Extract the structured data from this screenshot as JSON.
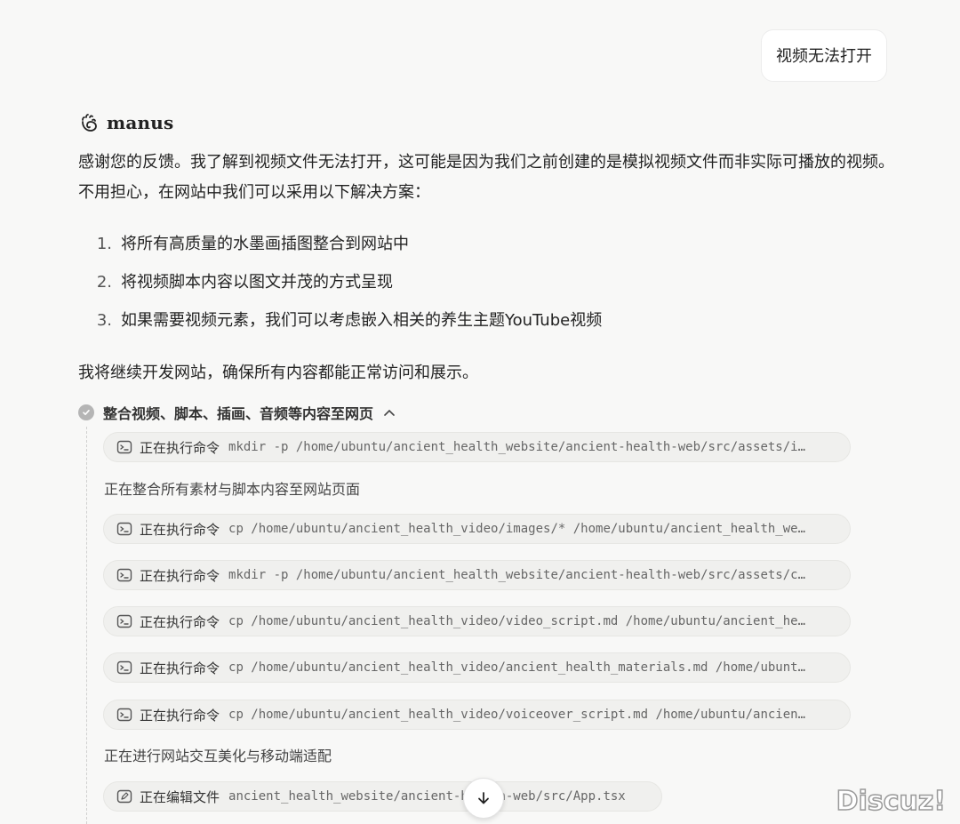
{
  "user_message": "视频无法打开",
  "assistant": {
    "name": "manus",
    "intro": "感谢您的反馈。我了解到视频文件无法打开，这可能是因为我们之前创建的是模拟视频文件而非实际可播放的视频。不用担心，在网站中我们可以采用以下解决方案：",
    "solutions": [
      {
        "num": "1.",
        "text": "将所有高质量的水墨画插图整合到网站中"
      },
      {
        "num": "2.",
        "text": "将视频脚本内容以图文并茂的方式呈现"
      },
      {
        "num": "3.",
        "text": "如果需要视频元素，我们可以考虑嵌入相关的养生主题YouTube视频"
      }
    ],
    "closing": "我将继续开发网站，确保所有内容都能正常访问和展示。"
  },
  "task": {
    "title": "整合视频、脚本、插画、音频等内容至网页",
    "caret_icon": "chevron-up-icon",
    "items": [
      {
        "type": "command",
        "label": "正在执行命令",
        "code": "mkdir -p /home/ubuntu/ancient_health_website/ancient-health-web/src/assets/i…"
      },
      {
        "type": "step",
        "text": "正在整合所有素材与脚本内容至网站页面"
      },
      {
        "type": "command",
        "label": "正在执行命令",
        "code": "cp /home/ubuntu/ancient_health_video/images/* /home/ubuntu/ancient_health_we…"
      },
      {
        "type": "command",
        "label": "正在执行命令",
        "code": "mkdir -p /home/ubuntu/ancient_health_website/ancient-health-web/src/assets/c…"
      },
      {
        "type": "command",
        "label": "正在执行命令",
        "code": "cp /home/ubuntu/ancient_health_video/video_script.md /home/ubuntu/ancient_he…"
      },
      {
        "type": "command",
        "label": "正在执行命令",
        "code": "cp /home/ubuntu/ancient_health_video/ancient_health_materials.md /home/ubunt…"
      },
      {
        "type": "command",
        "label": "正在执行命令",
        "code": "cp /home/ubuntu/ancient_health_video/voiceover_script.md /home/ubuntu/ancien…"
      },
      {
        "type": "step",
        "text": "正在进行网站交互美化与移动端适配"
      },
      {
        "type": "edit",
        "label": "正在编辑文件",
        "code": "ancient_health_website/ancient-health-web/src/App.tsx"
      }
    ]
  },
  "watermark": "Discuz!",
  "colors": {
    "background": "#f8f8f7",
    "pill": "#f0f0ee",
    "check": "#b5b5b5"
  }
}
